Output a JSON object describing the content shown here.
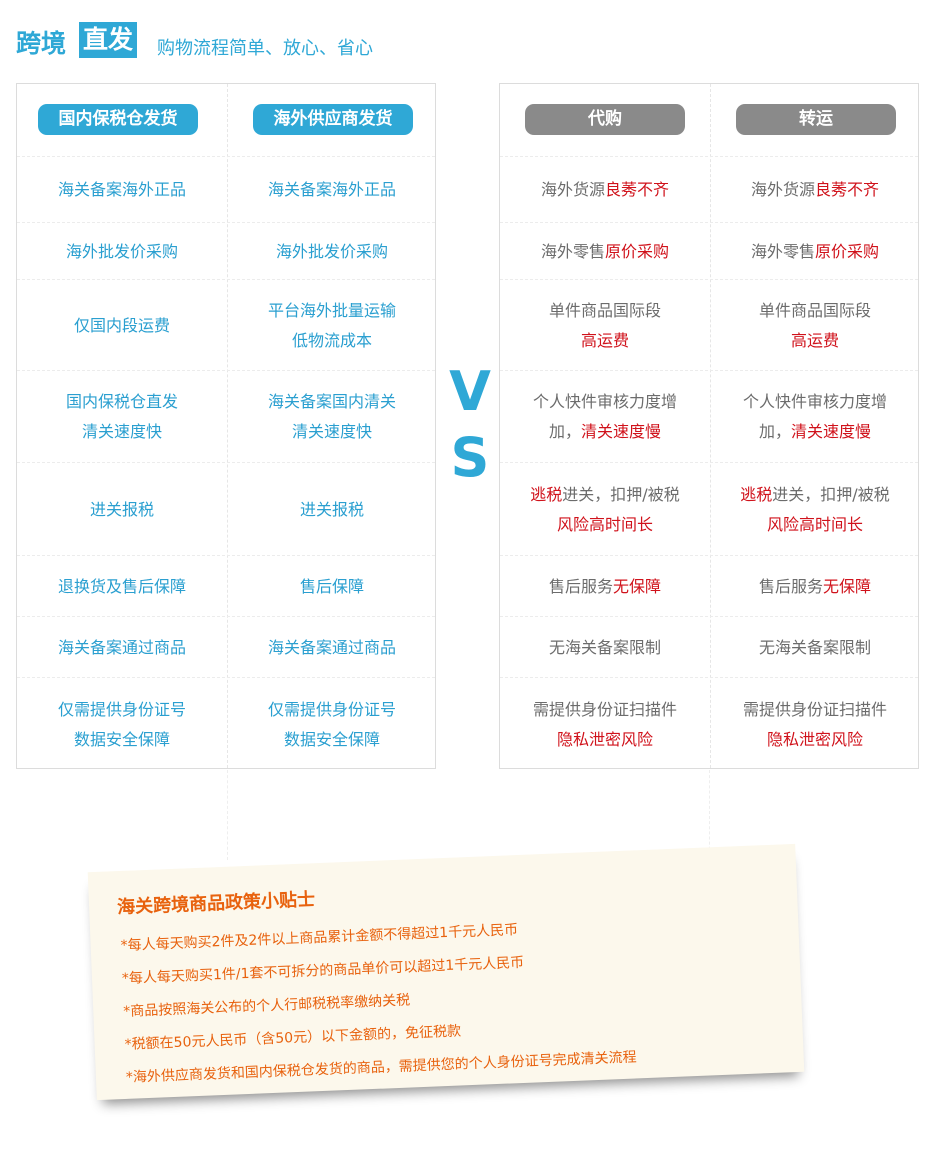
{
  "header": {
    "title_part1": "跨境",
    "title_part2": "直发",
    "subtitle": "购物流程简单、放心、省心"
  },
  "vs": {
    "v": "V",
    "s": "S"
  },
  "left": {
    "headers": [
      "国内保税仓发货",
      "海外供应商发货"
    ],
    "rows": [
      [
        [
          [
            "海关备案海外正品"
          ]
        ],
        [
          [
            "海关备案海外正品"
          ]
        ]
      ],
      [
        [
          [
            "海外批发价采购"
          ]
        ],
        [
          [
            "海外批发价采购"
          ]
        ]
      ],
      [
        [
          [
            "仅国内段运费"
          ]
        ],
        [
          [
            "平台海外批量运输"
          ],
          [
            "低物流成本"
          ]
        ]
      ],
      [
        [
          [
            "国内保税仓直发"
          ],
          [
            "清关速度快"
          ]
        ],
        [
          [
            "海关备案国内清关"
          ],
          [
            "清关速度快"
          ]
        ]
      ],
      [
        [
          [
            "进关报税"
          ]
        ],
        [
          [
            "进关报税"
          ]
        ]
      ],
      [
        [
          [
            "退换货及售后保障"
          ]
        ],
        [
          [
            "售后保障"
          ]
        ]
      ],
      [
        [
          [
            "海关备案通过商品"
          ]
        ],
        [
          [
            "海关备案通过商品"
          ]
        ]
      ],
      [
        [
          [
            "仅需提供身份证号"
          ],
          [
            "数据安全保障"
          ]
        ],
        [
          [
            "仅需提供身份证号"
          ],
          [
            "数据安全保障"
          ]
        ]
      ]
    ]
  },
  "right": {
    "headers": [
      "代购",
      "转运"
    ],
    "rows": [
      [
        [
          [
            "海外货源",
            "良莠不齐"
          ]
        ],
        [
          [
            "海外货源",
            "良莠不齐"
          ]
        ]
      ],
      [
        [
          [
            "海外零售",
            "原价采购"
          ]
        ],
        [
          [
            "海外零售",
            "原价采购"
          ]
        ]
      ],
      [
        [
          [
            "单件商品国际段"
          ],
          [
            "",
            "高运费"
          ]
        ],
        [
          [
            "单件商品国际段"
          ],
          [
            "",
            "高运费"
          ]
        ]
      ],
      [
        [
          [
            "个人快件审核力度增"
          ],
          [
            "加，",
            "清关速度慢"
          ]
        ],
        [
          [
            "个人快件审核力度增"
          ],
          [
            "加，",
            "清关速度慢"
          ]
        ]
      ],
      [
        [
          [
            "",
            "逃税",
            "进关，扣押/被税"
          ],
          [
            "",
            "风险高时间长"
          ]
        ],
        [
          [
            "",
            "逃税",
            "进关，扣押/被税"
          ],
          [
            "",
            "风险高时间长"
          ]
        ]
      ],
      [
        [
          [
            "售后服务",
            "无保障"
          ]
        ],
        [
          [
            "售后服务",
            "无保障"
          ]
        ]
      ],
      [
        [
          [
            "无海关备案限制"
          ]
        ],
        [
          [
            "无海关备案限制"
          ]
        ]
      ],
      [
        [
          [
            "需提供身份证扫描件"
          ],
          [
            "",
            "隐私泄密风险"
          ]
        ],
        [
          [
            "需提供身份证扫描件"
          ],
          [
            "",
            "隐私泄密风险"
          ]
        ]
      ]
    ]
  },
  "tips": {
    "title": "海关跨境商品政策小贴士",
    "lines": [
      "*每人每天购买2件及2件以上商品累计金额不得超过1千元人民币",
      "*每人每天购买1件/1套不可拆分的商品单价可以超过1千元人民币",
      "*商品按照海关公布的个人行邮税税率缴纳关税",
      "*税额在50元人民币（含50元）以下金额的，免征税款",
      "*海外供应商发货和国内保税仓发货的商品，需提供您的个人身份证号完成清关流程"
    ]
  },
  "colors": {
    "accent": "#2fa8d6",
    "warning": "#d0121b",
    "muted": "#6c6c6c",
    "pill_gray": "#8a8a8a",
    "note_text": "#e8620e",
    "note_bg": "#fcf8ec"
  }
}
